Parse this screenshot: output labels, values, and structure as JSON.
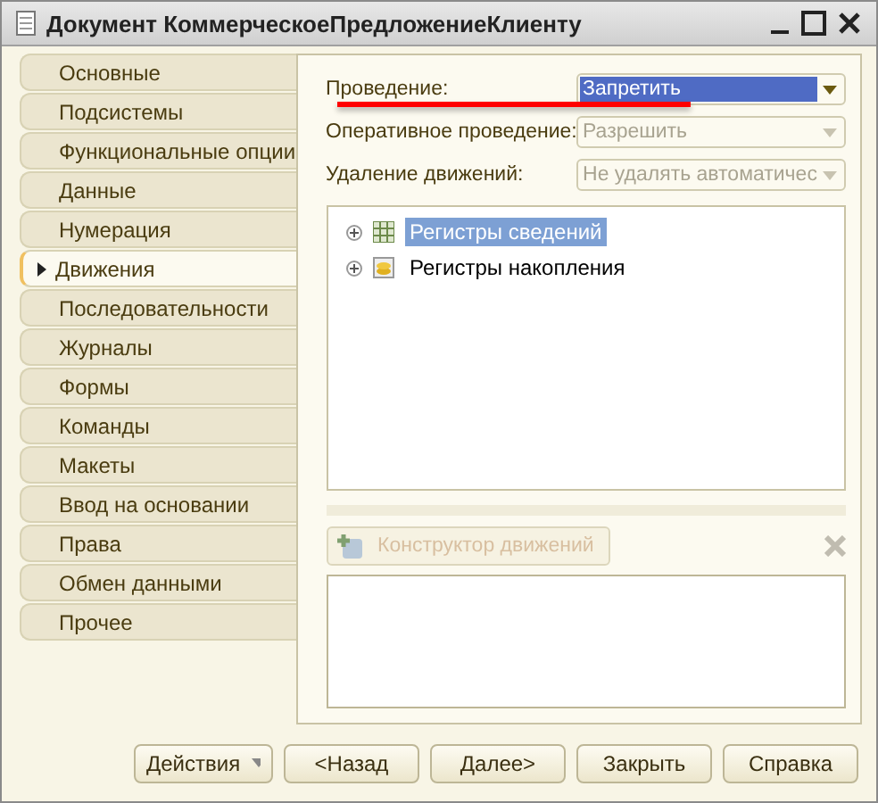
{
  "window": {
    "title": "Документ КоммерческоеПредложениеКлиенту"
  },
  "tabs": [
    {
      "label": "Основные",
      "selected": false
    },
    {
      "label": "Подсистемы",
      "selected": false
    },
    {
      "label": "Функциональные опции",
      "selected": false
    },
    {
      "label": "Данные",
      "selected": false
    },
    {
      "label": "Нумерация",
      "selected": false
    },
    {
      "label": "Движения",
      "selected": true
    },
    {
      "label": "Последовательности",
      "selected": false
    },
    {
      "label": "Журналы",
      "selected": false
    },
    {
      "label": "Формы",
      "selected": false
    },
    {
      "label": "Команды",
      "selected": false
    },
    {
      "label": "Макеты",
      "selected": false
    },
    {
      "label": "Ввод на основании",
      "selected": false
    },
    {
      "label": "Права",
      "selected": false
    },
    {
      "label": "Обмен данными",
      "selected": false
    },
    {
      "label": "Прочее",
      "selected": false
    }
  ],
  "fields": [
    {
      "label": "Проведение:",
      "value": "Запретить",
      "disabled": false,
      "highlighted": true
    },
    {
      "label": "Оперативное проведение:",
      "value": "Разрешить",
      "disabled": true,
      "highlighted": false
    },
    {
      "label": "Удаление движений:",
      "value": "Не удалять автоматичес",
      "disabled": true,
      "highlighted": false
    }
  ],
  "tree": [
    {
      "label": "Регистры сведений",
      "kind": "table",
      "selected": true,
      "expanded": false
    },
    {
      "label": "Регистры накопления",
      "kind": "coins",
      "selected": false,
      "expanded": false
    }
  ],
  "constructor_button": {
    "label": "Конструктор движений",
    "disabled": true
  },
  "buttons": [
    {
      "label": "Действия",
      "kind": "menu"
    },
    {
      "label": "<Назад",
      "kind": "plain"
    },
    {
      "label": "Далее>",
      "kind": "plain"
    },
    {
      "label": "Закрыть",
      "kind": "plain"
    },
    {
      "label": "Справка",
      "kind": "plain"
    }
  ]
}
